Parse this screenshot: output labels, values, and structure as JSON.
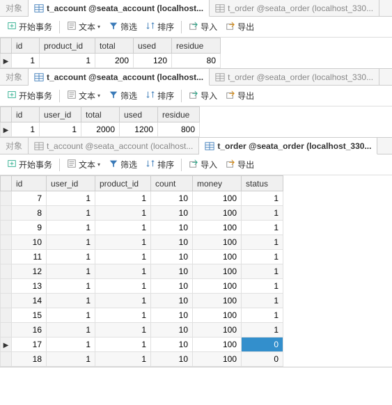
{
  "tabs": {
    "object": "对象",
    "account": "t_account @seata_account (localhost...",
    "order": "t_order @seata_order (localhost_330..."
  },
  "toolbar": {
    "begin_tx": "开始事务",
    "text": "文本",
    "filter": "筛选",
    "sort": "排序",
    "import": "导入",
    "export": "导出"
  },
  "panel1": {
    "headers": [
      "id",
      "product_id",
      "total",
      "used",
      "residue"
    ],
    "rows": [
      [
        "1",
        "1",
        "200",
        "120",
        "80"
      ]
    ]
  },
  "panel2": {
    "headers": [
      "id",
      "user_id",
      "total",
      "used",
      "residue"
    ],
    "rows": [
      [
        "1",
        "1",
        "2000",
        "1200",
        "800"
      ]
    ]
  },
  "panel3": {
    "headers": [
      "id",
      "user_id",
      "product_id",
      "count",
      "money",
      "status"
    ],
    "rows": [
      [
        "7",
        "1",
        "1",
        "10",
        "100",
        "1"
      ],
      [
        "8",
        "1",
        "1",
        "10",
        "100",
        "1"
      ],
      [
        "9",
        "1",
        "1",
        "10",
        "100",
        "1"
      ],
      [
        "10",
        "1",
        "1",
        "10",
        "100",
        "1"
      ],
      [
        "11",
        "1",
        "1",
        "10",
        "100",
        "1"
      ],
      [
        "12",
        "1",
        "1",
        "10",
        "100",
        "1"
      ],
      [
        "13",
        "1",
        "1",
        "10",
        "100",
        "1"
      ],
      [
        "14",
        "1",
        "1",
        "10",
        "100",
        "1"
      ],
      [
        "15",
        "1",
        "1",
        "10",
        "100",
        "1"
      ],
      [
        "16",
        "1",
        "1",
        "10",
        "100",
        "1"
      ],
      [
        "17",
        "1",
        "1",
        "10",
        "100",
        "0"
      ],
      [
        "18",
        "1",
        "1",
        "10",
        "100",
        "0"
      ]
    ]
  }
}
